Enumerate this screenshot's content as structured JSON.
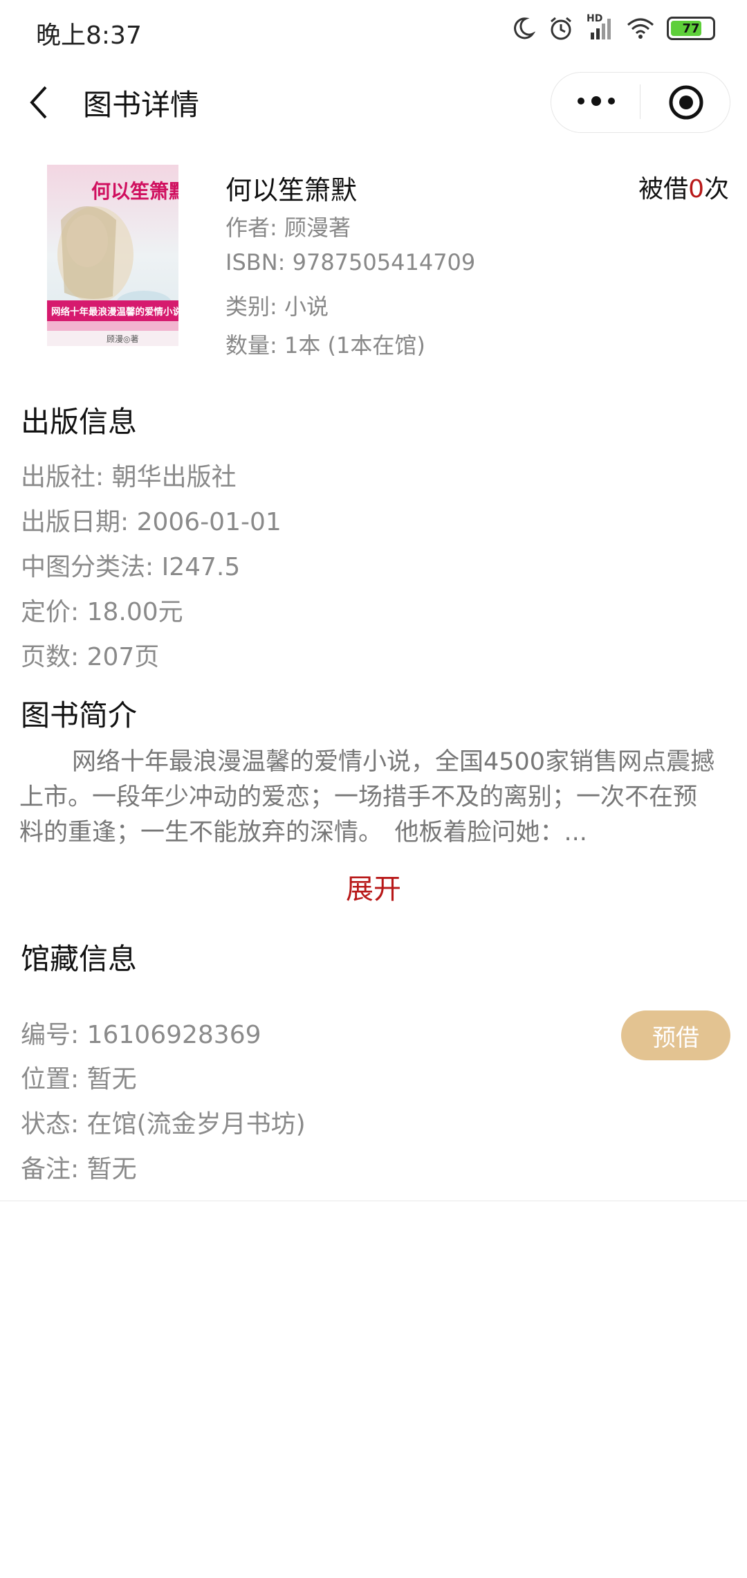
{
  "status_bar": {
    "time": "晚上8:37",
    "battery": "77",
    "network_label": "HD",
    "icons": [
      "moon-icon",
      "alarm-icon",
      "signal-icon",
      "wifi-icon",
      "battery-icon"
    ]
  },
  "nav": {
    "title": "图书详情",
    "icons": [
      "back-icon",
      "more-icon",
      "close-miniprogram-icon"
    ]
  },
  "book": {
    "title": "何以笙箫默",
    "borrow_prefix": "被借",
    "borrow_count": "0",
    "borrow_suffix": "次",
    "author": "作者: 顾漫著",
    "isbn": "ISBN: 9787505414709",
    "category": "类别: 小说",
    "quantity": "数量: 1本 (1本在馆)",
    "cover": {
      "title_text": "何以笙箫默",
      "banner_text": "网络十年最浪漫温馨的爱情小说",
      "author_text": "顾漫◎著"
    }
  },
  "publish": {
    "heading": "出版信息",
    "publisher": "出版社: 朝华出版社",
    "date": "出版日期: 2006-01-01",
    "classification": "中图分类法: I247.5",
    "price": "定价: 18.00元",
    "pages": "页数: 207页"
  },
  "intro": {
    "heading": "图书简介",
    "text": "网络十年最浪漫温馨的爱情小说，全国4500家销售网点震撼上市。一段年少冲动的爱恋；一场措手不及的离别；一次不在预料的重逢；一生不能放弃的深情。　他板着脸问她：...",
    "expand_label": "展开"
  },
  "holdings": {
    "heading": "馆藏信息",
    "number": "编号: 16106928369",
    "location": "位置: 暂无",
    "status": "状态: 在馆(流金岁月书坊)",
    "note": "备注: 暂无",
    "reserve_label": "预借"
  },
  "colors": {
    "accent_red": "#b81818",
    "reserve_button": "#e3c391",
    "secondary_text": "#8a8a8a"
  }
}
